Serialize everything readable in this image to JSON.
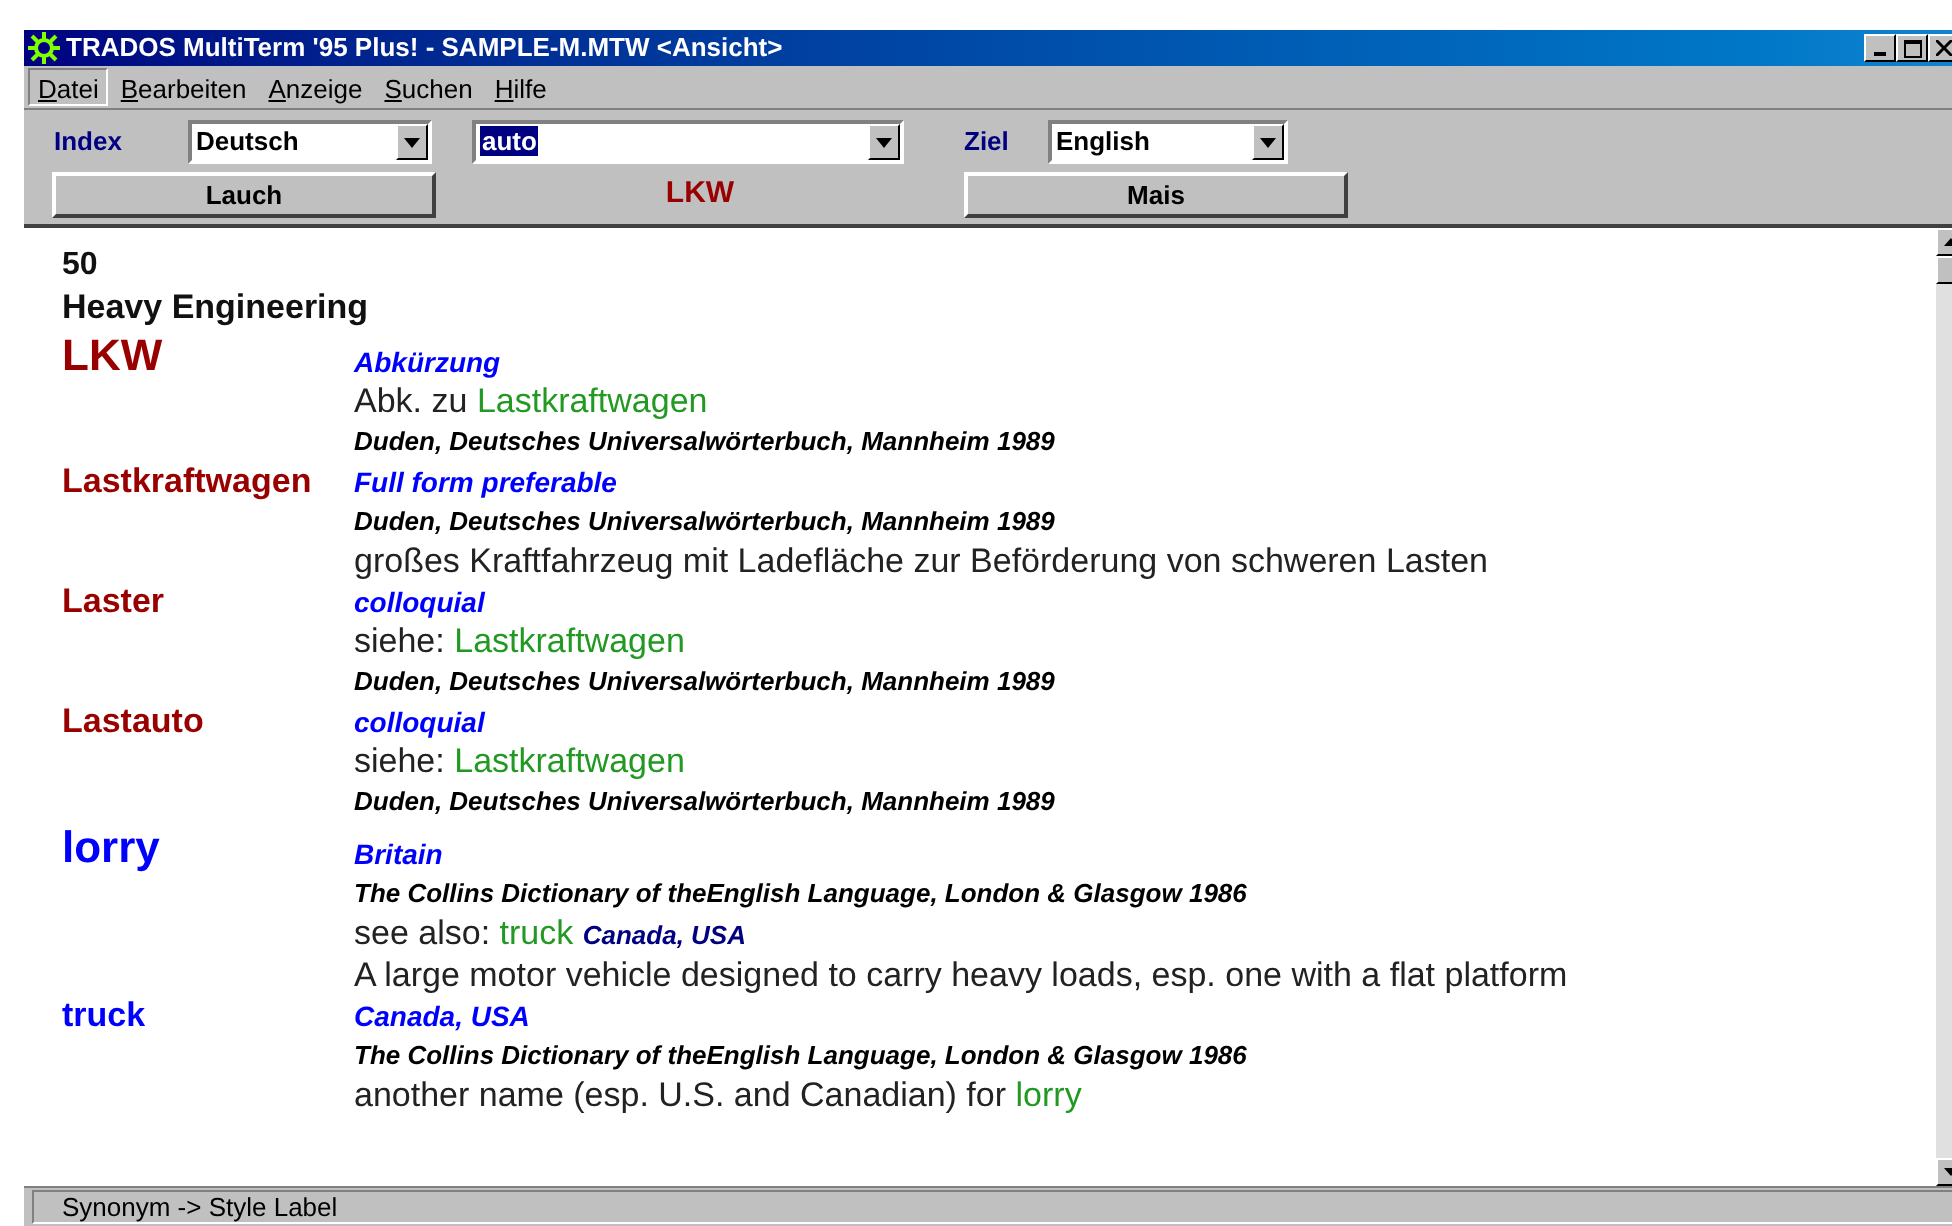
{
  "window": {
    "title": "TRADOS MultiTerm '95 Plus! - SAMPLE-M.MTW <Ansicht>"
  },
  "menu": [
    {
      "label": "Datei",
      "selected": true
    },
    {
      "label": "Bearbeiten",
      "selected": false
    },
    {
      "label": "Anzeige",
      "selected": false
    },
    {
      "label": "Suchen",
      "selected": false
    },
    {
      "label": "Hilfe",
      "selected": false
    }
  ],
  "toolbar": {
    "index_label": "Index",
    "index_value": "Deutsch",
    "search_value": "auto",
    "target_label": "Ziel",
    "target_value": "English",
    "prev_button": "Lauch",
    "current_term": "LKW",
    "next_button": "Mais"
  },
  "entry": {
    "number": "50",
    "subject": "Heavy Engineering",
    "terms": [
      {
        "term": "LKW",
        "color": "#990000",
        "large": true,
        "lines": [
          {
            "kind": "label",
            "text": "Abkürzung"
          },
          {
            "kind": "text",
            "parts": [
              {
                "kind": "plain",
                "text": "Abk. zu"
              },
              {
                "kind": "link",
                "text": "Lastkraftwagen"
              }
            ]
          },
          {
            "kind": "source",
            "text": "Duden, Deutsches Universalwörterbuch, Mannheim 1989"
          }
        ]
      },
      {
        "term": "Lastkraftwagen",
        "color": "#990000",
        "large": false,
        "lines": [
          {
            "kind": "label",
            "text": "Full form preferable"
          },
          {
            "kind": "source",
            "text": "Duden, Deutsches Universalwörterbuch, Mannheim 1989"
          },
          {
            "kind": "text",
            "parts": [
              {
                "kind": "plain",
                "text": "großes Kraftfahrzeug mit Ladefläche zur Beförderung von schweren Lasten"
              }
            ]
          }
        ]
      },
      {
        "term": "Laster",
        "color": "#990000",
        "large": false,
        "lines": [
          {
            "kind": "label",
            "text": "colloquial"
          },
          {
            "kind": "text",
            "parts": [
              {
                "kind": "plain",
                "text": "siehe:"
              },
              {
                "kind": "link",
                "text": "Lastkraftwagen"
              }
            ]
          },
          {
            "kind": "source",
            "text": "Duden, Deutsches Universalwörterbuch, Mannheim 1989"
          }
        ]
      },
      {
        "term": "Lastauto",
        "color": "#990000",
        "large": false,
        "lines": [
          {
            "kind": "label",
            "text": "colloquial"
          },
          {
            "kind": "text",
            "parts": [
              {
                "kind": "plain",
                "text": "siehe:"
              },
              {
                "kind": "link",
                "text": "Lastkraftwagen"
              }
            ]
          },
          {
            "kind": "source",
            "text": "Duden, Deutsches Universalwörterbuch, Mannheim 1989"
          }
        ]
      },
      {
        "term": "lorry",
        "color": "#0000ff",
        "large": true,
        "lines": [
          {
            "kind": "label",
            "text": "Britain"
          },
          {
            "kind": "source",
            "text": "The Collins Dictionary of theEnglish Language, London & Glasgow 1986"
          },
          {
            "kind": "text",
            "parts": [
              {
                "kind": "plain",
                "text": "see also:"
              },
              {
                "kind": "link",
                "text": "truck"
              },
              {
                "kind": "label",
                "text": "Canada, USA"
              }
            ]
          },
          {
            "kind": "text",
            "parts": [
              {
                "kind": "plain",
                "text": "A large motor vehicle designed to carry heavy loads, esp. one with a flat platform"
              }
            ]
          }
        ]
      },
      {
        "term": "truck",
        "color": "#0000ff",
        "large": false,
        "lines": [
          {
            "kind": "label",
            "text": "Canada, USA"
          },
          {
            "kind": "source",
            "text": "The Collins Dictionary of theEnglish Language, London & Glasgow 1986"
          },
          {
            "kind": "text",
            "parts": [
              {
                "kind": "plain",
                "text": "another name (esp. U.S. and Canadian) for"
              },
              {
                "kind": "link",
                "text": "lorry"
              }
            ]
          }
        ]
      }
    ]
  },
  "status_bar": "Synonym -> Style Label"
}
